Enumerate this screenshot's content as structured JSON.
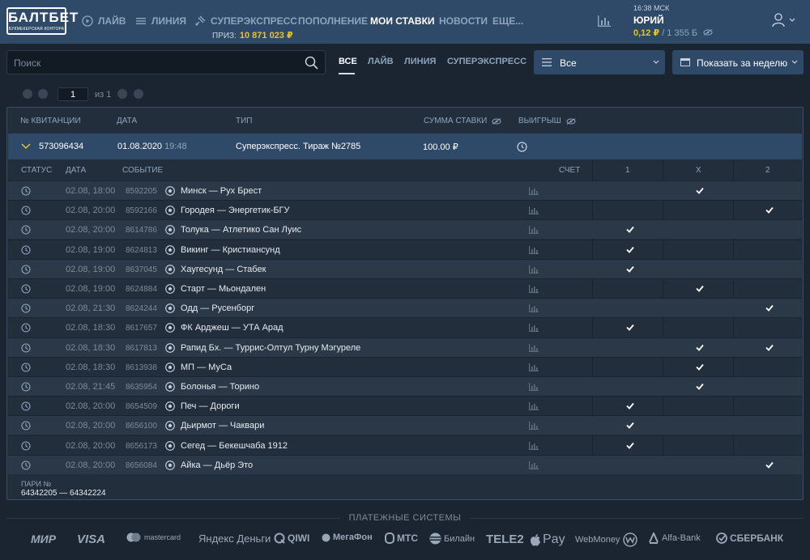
{
  "header": {
    "logo_main": "БАЛТБЕТ",
    "logo_sub": "БУКМЕКЕРСКАЯ КОНТОРА",
    "nav": [
      {
        "label": "ЛАЙВ",
        "icon": "play-circle-icon"
      },
      {
        "label": "ЛИНИЯ",
        "icon": "list-lines-icon"
      },
      {
        "label": "СУПЕРЭКСПРЕСС",
        "icon": "satellite-icon"
      },
      {
        "label": "ПОПОЛНЕНИЕ"
      },
      {
        "label": "МОИ СТАВКИ",
        "active": true
      },
      {
        "label": "НОВОСТИ"
      },
      {
        "label": "ЕЩЕ..."
      }
    ],
    "prize_label": "ПРИЗ:",
    "prize_value": "10 871 023 ₽",
    "time": "16:38 МСК",
    "user_name": "ЮРИЙ",
    "balance_main": "0,12 ₽",
    "balance_bonus": "/ 1 355 Б"
  },
  "toolbar": {
    "search_placeholder": "Поиск",
    "tabs": [
      "ВСЕ",
      "ЛАЙВ",
      "ЛИНИЯ",
      "СУПЕРЭКСПРЕСС"
    ],
    "filter_select": "Все",
    "period_select": "Показать за неделю"
  },
  "pagination": {
    "current": "1",
    "of_label": "из 1"
  },
  "table": {
    "headers": {
      "receipt": "№ КВИТАНЦИИ",
      "date": "ДАТА",
      "type": "ТИП",
      "sum": "СУММА СТАВКИ",
      "win": "ВЫИГРЫШ"
    },
    "ticket": {
      "number": "573096434",
      "date": "01.08.2020",
      "time": "19:48",
      "type": "Суперэкспресс. Тираж №2785",
      "sum": "100.00 ₽"
    },
    "sub_headers": {
      "status": "СТАТУС",
      "date": "ДАТА",
      "event": "СОБЫТИЕ",
      "score": "СЧЕТ",
      "one": "1",
      "x": "X",
      "two": "2"
    },
    "events": [
      {
        "date": "02.08,",
        "time": "18:00",
        "id": "8592205",
        "name": "Минск — Рух Брест",
        "picks": [
          "x"
        ]
      },
      {
        "date": "02.08,",
        "time": "20:00",
        "id": "8592166",
        "name": "Городея — Энергетик-БГУ",
        "picks": [
          "2"
        ]
      },
      {
        "date": "02.08,",
        "time": "20:00",
        "id": "8614786",
        "name": "Толука — Атлетико Сан Луис",
        "picks": [
          "1"
        ]
      },
      {
        "date": "02.08,",
        "time": "19:00",
        "id": "8624813",
        "name": "Викинг — Кристиансунд",
        "picks": [
          "1"
        ]
      },
      {
        "date": "02.08,",
        "time": "19:00",
        "id": "8637045",
        "name": "Хаугесунд — Стабек",
        "picks": [
          "1"
        ]
      },
      {
        "date": "02.08,",
        "time": "19:00",
        "id": "8624884",
        "name": "Старт — Мьондален",
        "picks": [
          "x"
        ]
      },
      {
        "date": "02.08,",
        "time": "21:30",
        "id": "8624244",
        "name": "Одд — Русенборг",
        "picks": [
          "2"
        ]
      },
      {
        "date": "02.08,",
        "time": "18:30",
        "id": "8617657",
        "name": "ФК Арджеш — УТА Арад",
        "picks": [
          "1"
        ]
      },
      {
        "date": "02.08,",
        "time": "18:30",
        "id": "8617813",
        "name": "Рапид Бх. — Туррис-Олтул Турну Мэгуреле",
        "picks": [
          "x",
          "2"
        ]
      },
      {
        "date": "02.08,",
        "time": "18:30",
        "id": "8613938",
        "name": "МП — МуСа",
        "picks": [
          "x"
        ]
      },
      {
        "date": "02.08,",
        "time": "21:45",
        "id": "8635954",
        "name": "Болонья — Торино",
        "picks": [
          "x"
        ]
      },
      {
        "date": "02.08,",
        "time": "20:00",
        "id": "8654509",
        "name": "Печ — Дороги",
        "picks": [
          "1"
        ]
      },
      {
        "date": "02.08,",
        "time": "20:00",
        "id": "8656100",
        "name": "Дьирмот — Чаквари",
        "picks": [
          "1"
        ]
      },
      {
        "date": "02.08,",
        "time": "20:00",
        "id": "8656173",
        "name": "Сегед — Бекешчаба 1912",
        "picks": [
          "1"
        ]
      },
      {
        "date": "02.08,",
        "time": "20:00",
        "id": "8656084",
        "name": "Айка — Дьёр Это",
        "picks": [
          "2"
        ]
      }
    ],
    "pari_label": "ПАРИ №",
    "pari_range": "64342205 — 64342224"
  },
  "footer": {
    "title": "ПЛАТЕЖНЫЕ СИСТЕМЫ",
    "systems": [
      "МИР",
      "VISA",
      "mastercard",
      "Яндекс Деньги",
      "QIWI",
      "МегаФон",
      "МТС",
      "Билайн",
      "TELE2",
      "Pay",
      "WebMoney",
      "Alfa-Bank",
      "СБЕРБАНК"
    ]
  },
  "colors": {
    "header_bg": "#2f4a69",
    "page_bg": "#1b2532",
    "accent_gold": "#e6c230",
    "row_alt": "#2b3847"
  }
}
